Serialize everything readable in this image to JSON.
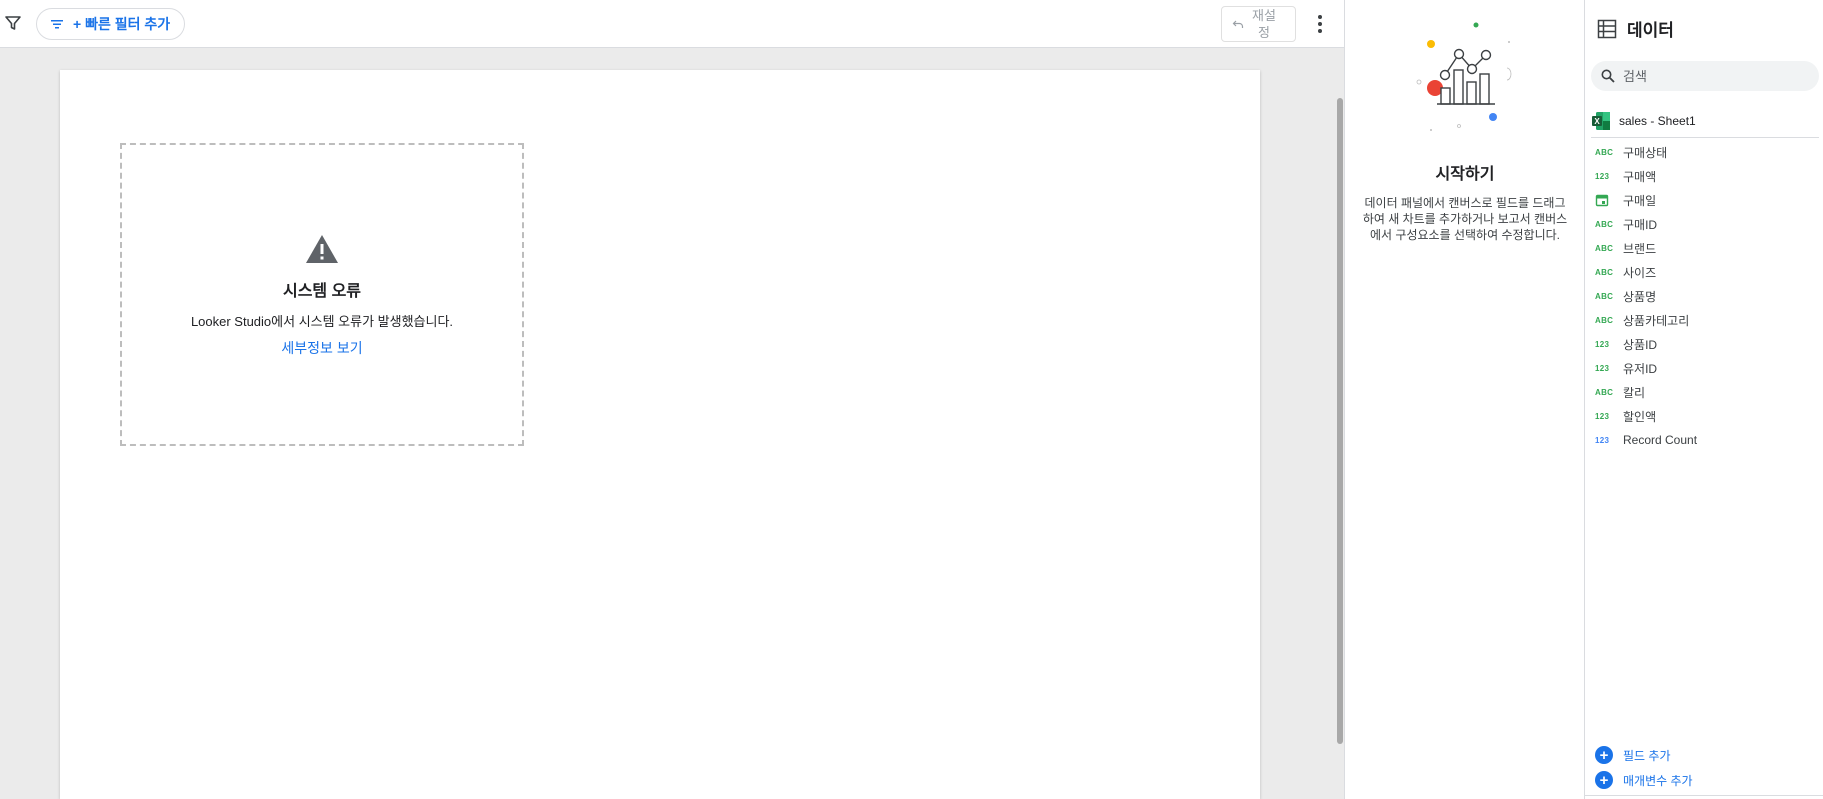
{
  "toolbar": {
    "quick_filter_label": "+ 빠른 필터 추가",
    "reset_label": "재설정"
  },
  "error": {
    "title": "시스템 오류",
    "message": "Looker Studio에서 시스템 오류가 발생했습니다.",
    "link": "세부정보 보기"
  },
  "start_panel": {
    "title": "시작하기",
    "description": "데이터 패널에서 캔버스로 필드를 드래그하여 새 차트를 추가하거나 보고서 캔버스에서 구성요소를 선택하여 수정합니다."
  },
  "data_panel": {
    "title": "데이터",
    "search_placeholder": "검색",
    "source": "sales - Sheet1",
    "fields": [
      {
        "type": "ABC",
        "name": "구매상태"
      },
      {
        "type": "123",
        "name": "구매액"
      },
      {
        "type": "date",
        "name": "구매일"
      },
      {
        "type": "ABC",
        "name": "구매ID"
      },
      {
        "type": "ABC",
        "name": "브랜드"
      },
      {
        "type": "ABC",
        "name": "사이즈"
      },
      {
        "type": "ABC",
        "name": "상품명"
      },
      {
        "type": "ABC",
        "name": "상품카테고리"
      },
      {
        "type": "123",
        "name": "상품ID"
      },
      {
        "type": "123",
        "name": "유저ID"
      },
      {
        "type": "ABC",
        "name": "칼리"
      },
      {
        "type": "123",
        "name": "할인액"
      },
      {
        "type": "123",
        "name": "Record Count",
        "metric": true
      }
    ],
    "add_field": "필드 추가",
    "add_parameter": "매개변수 추가"
  },
  "colors": {
    "accent": "#1a73e8",
    "dimension": "#34a853",
    "metric": "#4285f4"
  }
}
